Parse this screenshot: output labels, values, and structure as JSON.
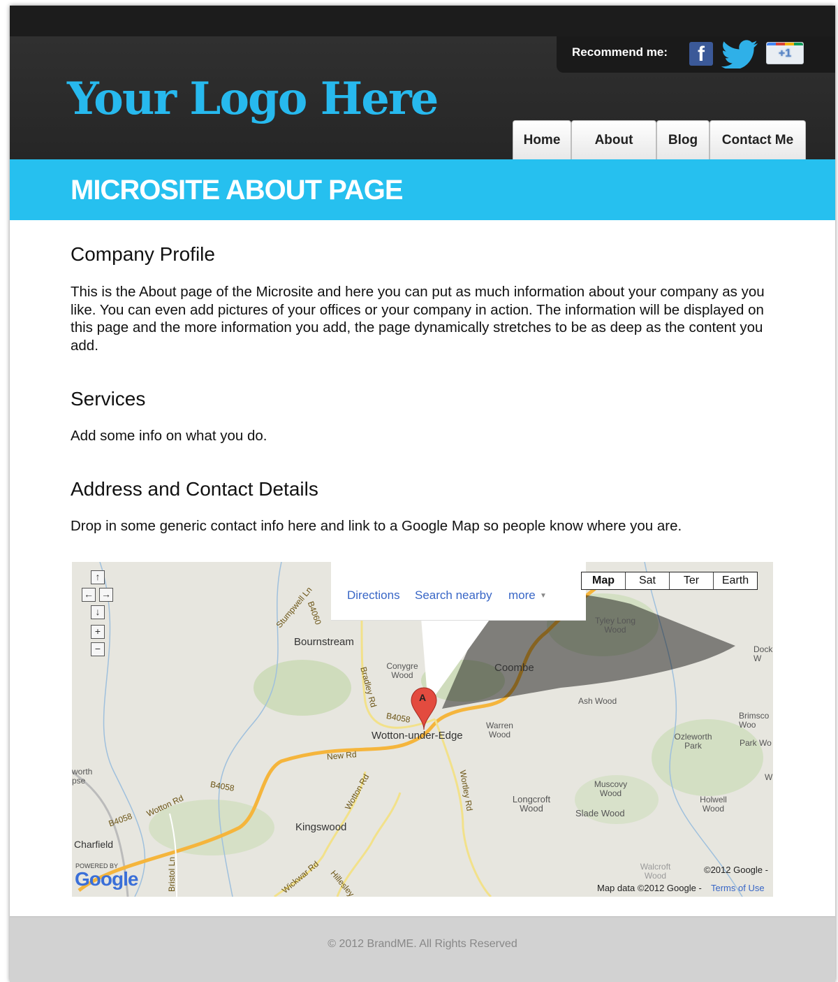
{
  "header": {
    "logo_text": "Your Logo Here",
    "recommend_label": "Recommend me:",
    "social": [
      {
        "name": "facebook-icon",
        "label": "f"
      },
      {
        "name": "twitter-icon",
        "label": ""
      },
      {
        "name": "google-plus-one-icon",
        "label": "+1"
      }
    ]
  },
  "nav": {
    "items": [
      {
        "label": "Home"
      },
      {
        "label": "About"
      },
      {
        "label": "Blog"
      },
      {
        "label": "Contact Me"
      }
    ]
  },
  "banner": {
    "title": "MICROSITE ABOUT PAGE"
  },
  "sections": [
    {
      "heading": "Company Profile",
      "body": "This is the About page of the Microsite and here you can put as much information about your company as you like. You can even add pictures of your offices or your company in action. The information will be displayed on this page and the more information you add, the page dynamically stretches to be as deep as the content you add."
    },
    {
      "heading": "Services",
      "body": "Add some info on what you do."
    },
    {
      "heading": "Address and Contact Details",
      "body": "Drop in some generic contact info here and link to a Google Map so people know where you are."
    }
  ],
  "map": {
    "types": [
      "Map",
      "Sat",
      "Ter",
      "Earth"
    ],
    "selected_type": "Map",
    "bubble_links": [
      "Directions",
      "Search nearby",
      "more"
    ],
    "marker_label": "A",
    "places": [
      "Bournstream",
      "Coombe",
      "Wotton-under-Edge",
      "Kingswood",
      "Charfield"
    ],
    "small_places": [
      "Conygre Wood",
      "Tyley Long Wood",
      "Ash Wood",
      "Warren Wood",
      "Ozleworth Park",
      "Park Wo",
      "Brimsco Woo",
      "Dock W",
      "Muscovy Wood",
      "Longcroft Wood",
      "Slade Wood",
      "Holwell Wood",
      "Walcroft Wood",
      "worth pse",
      "W"
    ],
    "roads": [
      "Stumpwell Ln",
      "B4060",
      "Bradley Rd",
      "B4058",
      "New Rd",
      "Wotton Rd",
      "B4058",
      "Wortley Rd",
      "B4058",
      "Wotton Rd",
      "Bristol Ln",
      "Wickwar Rd",
      "Hillesley"
    ],
    "powered_by": "POWERED BY",
    "google_logo": "Google",
    "copyright": "©2012 Google -",
    "map_data": "Map data ©2012 Google -",
    "terms": "Terms of Use"
  },
  "footer": {
    "text": "© 2012 BrandME. All Rights Reserved"
  },
  "colors": {
    "accent": "#26c0ef",
    "header": "#2b2b2b",
    "footer": "#d2d2d2",
    "link": "#3866c6"
  }
}
